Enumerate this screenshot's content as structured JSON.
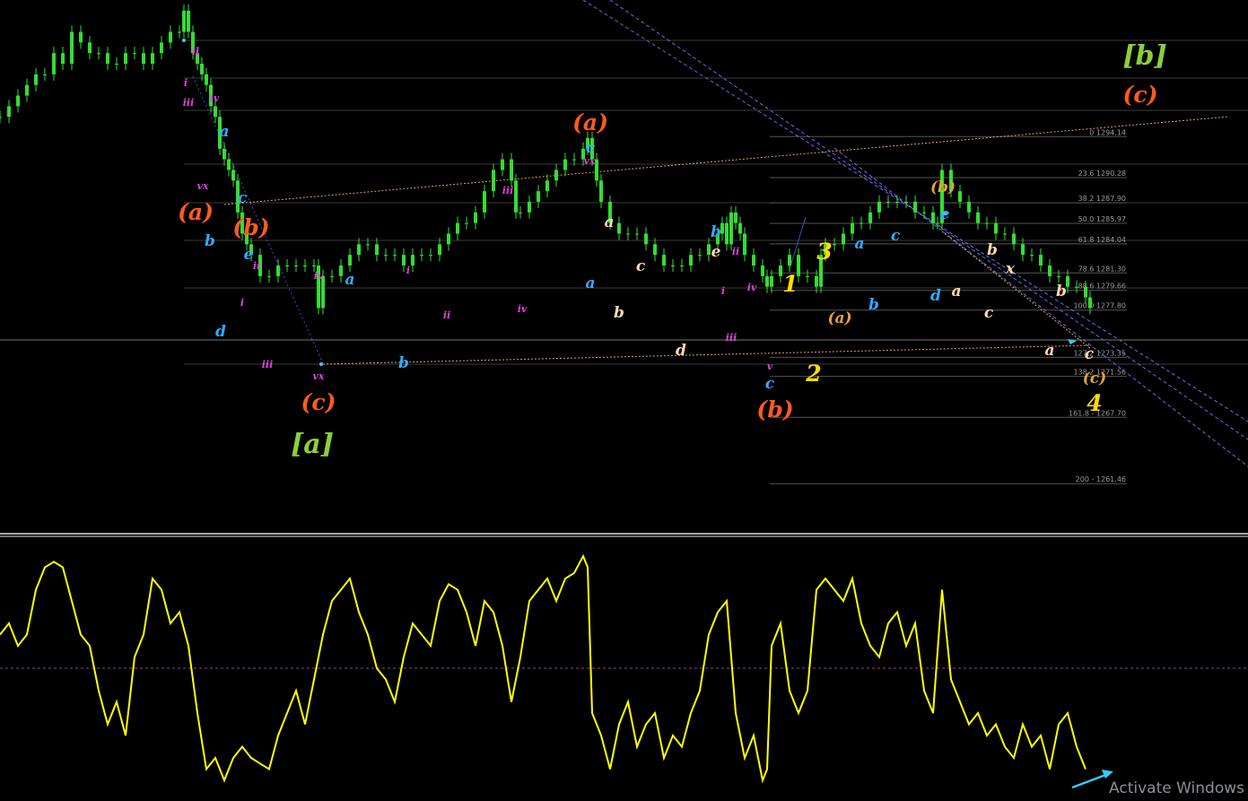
{
  "window": {
    "watermark": "Activate Windows"
  },
  "colors": {
    "background": "#000000",
    "candle": "#33dd33",
    "oscillator": "#ffff00",
    "grid": "#3a3a3a",
    "fib": "#555555",
    "channel": "#6a6ae8",
    "dotted_orange": "#e8a060",
    "osc_mid": "#aa33aa",
    "separator": "#e0e0e0",
    "arrow": "#33ccff"
  },
  "chart_data": [
    {
      "type": "candlestick",
      "title": "",
      "xlabel": "",
      "ylabel": "",
      "ylim": [
        1257,
        1307
      ],
      "x": [
        0,
        10,
        20,
        30,
        40,
        50,
        60,
        70,
        80,
        90,
        100,
        110,
        120,
        130,
        140,
        150,
        160,
        170,
        180,
        190,
        200,
        205,
        210,
        215,
        220,
        225,
        230,
        235,
        240,
        245,
        250,
        255,
        260,
        265,
        270,
        275,
        280,
        290,
        300,
        310,
        320,
        330,
        340,
        350,
        355,
        360,
        370,
        380,
        390,
        400,
        410,
        420,
        430,
        440,
        450,
        460,
        470,
        480,
        490,
        500,
        510,
        520,
        530,
        540,
        550,
        560,
        570,
        575,
        580,
        590,
        600,
        610,
        620,
        630,
        640,
        650,
        655,
        660,
        665,
        670,
        680,
        690,
        700,
        710,
        720,
        730,
        740,
        750,
        760,
        770,
        780,
        790,
        800,
        805,
        810,
        815,
        820,
        825,
        830,
        840,
        850,
        855,
        860,
        870,
        880,
        890,
        900,
        910,
        915,
        920,
        930,
        940,
        950,
        960,
        970,
        980,
        990,
        1000,
        1010,
        1020,
        1030,
        1040,
        1045,
        1050,
        1060,
        1070,
        1080,
        1090,
        1100,
        1110,
        1120,
        1130,
        1140,
        1150,
        1160,
        1170,
        1180,
        1190,
        1200,
        1210,
        1215
      ],
      "values": [
        1296,
        1297,
        1298,
        1299,
        1300,
        1300,
        1302,
        1301,
        1304,
        1303,
        1302,
        1302,
        1301,
        1301,
        1302,
        1302,
        1301,
        1302,
        1303,
        1304,
        1304,
        1306,
        1304,
        1302,
        1301,
        1300,
        1299,
        1297,
        1296,
        1293,
        1292,
        1291,
        1290,
        1287,
        1285,
        1284,
        1283,
        1281,
        1281,
        1282,
        1282,
        1282,
        1282,
        1282,
        1278,
        1281,
        1281,
        1282,
        1283,
        1284,
        1284,
        1283,
        1283,
        1283,
        1282,
        1283,
        1283,
        1283,
        1284,
        1285,
        1286,
        1286,
        1287,
        1289,
        1291,
        1292,
        1290,
        1287,
        1287,
        1288,
        1289,
        1290,
        1291,
        1292,
        1292,
        1293,
        1294,
        1292,
        1290,
        1288,
        1286,
        1285,
        1285,
        1285,
        1284,
        1283,
        1282,
        1282,
        1282,
        1283,
        1283,
        1284,
        1285,
        1286,
        1284,
        1287,
        1286,
        1285,
        1283,
        1282,
        1281,
        1280,
        1281,
        1282,
        1283,
        1281,
        1281,
        1280,
        1283,
        1284,
        1284,
        1285,
        1286,
        1286,
        1287,
        1288,
        1288,
        1288,
        1288,
        1287,
        1287,
        1286,
        1286,
        1291,
        1289,
        1288,
        1287,
        1286,
        1286,
        1285,
        1285,
        1284,
        1283,
        1283,
        1282,
        1281,
        1281,
        1280,
        1280,
        1279,
        1278
      ]
    },
    {
      "type": "line",
      "title": "",
      "ylim": [
        -1,
        1
      ],
      "x": [
        0,
        10,
        20,
        30,
        40,
        50,
        60,
        70,
        80,
        90,
        100,
        110,
        120,
        130,
        140,
        150,
        160,
        170,
        180,
        190,
        200,
        210,
        220,
        230,
        240,
        250,
        260,
        270,
        280,
        290,
        300,
        310,
        320,
        330,
        340,
        350,
        360,
        370,
        380,
        390,
        400,
        410,
        420,
        430,
        440,
        450,
        460,
        470,
        480,
        490,
        500,
        510,
        520,
        530,
        540,
        550,
        560,
        570,
        580,
        590,
        600,
        610,
        620,
        630,
        640,
        650,
        655,
        660,
        670,
        680,
        690,
        700,
        710,
        720,
        730,
        740,
        750,
        760,
        770,
        780,
        790,
        800,
        810,
        820,
        830,
        840,
        850,
        855,
        860,
        870,
        880,
        890,
        900,
        910,
        920,
        930,
        940,
        950,
        960,
        970,
        980,
        990,
        1000,
        1010,
        1020,
        1030,
        1040,
        1050,
        1060,
        1070,
        1080,
        1090,
        1100,
        1110,
        1120,
        1130,
        1140,
        1150,
        1160,
        1170,
        1180,
        1190,
        1200,
        1210
      ],
      "values": [
        0.3,
        0.4,
        0.2,
        0.3,
        0.7,
        0.9,
        0.95,
        0.9,
        0.6,
        0.3,
        0.2,
        -0.2,
        -0.5,
        -0.3,
        -0.6,
        0.1,
        0.3,
        0.8,
        0.7,
        0.4,
        0.5,
        0.2,
        -0.4,
        -0.9,
        -0.8,
        -1.0,
        -0.8,
        -0.7,
        -0.8,
        -0.85,
        -0.9,
        -0.6,
        -0.4,
        -0.2,
        -0.5,
        -0.1,
        0.3,
        0.6,
        0.7,
        0.8,
        0.5,
        0.3,
        0.0,
        -0.1,
        -0.3,
        0.1,
        0.4,
        0.3,
        0.2,
        0.6,
        0.75,
        0.7,
        0.5,
        0.2,
        0.6,
        0.5,
        0.2,
        -0.3,
        0.1,
        0.6,
        0.7,
        0.8,
        0.6,
        0.8,
        0.85,
        1.0,
        0.9,
        -0.4,
        -0.6,
        -0.9,
        -0.5,
        -0.3,
        -0.7,
        -0.5,
        -0.4,
        -0.8,
        -0.6,
        -0.7,
        -0.4,
        -0.2,
        0.3,
        0.5,
        0.6,
        -0.4,
        -0.8,
        -0.6,
        -1.0,
        -0.9,
        0.2,
        0.4,
        -0.2,
        -0.4,
        -0.2,
        0.7,
        0.8,
        0.7,
        0.6,
        0.8,
        0.4,
        0.2,
        0.1,
        0.4,
        0.5,
        0.2,
        0.4,
        -0.2,
        -0.4,
        0.7,
        -0.1,
        -0.3,
        -0.5,
        -0.4,
        -0.6,
        -0.5,
        -0.7,
        -0.8,
        -0.5,
        -0.7,
        -0.6,
        -0.9,
        -0.5,
        -0.4,
        -0.7,
        -0.9
      ]
    }
  ],
  "fib_levels": [
    {
      "label": "0 1294.14",
      "price": 1294.14
    },
    {
      "label": "23.6 1290.28",
      "price": 1290.28
    },
    {
      "label": "38.2 1287.90",
      "price": 1287.9
    },
    {
      "label": "50.0 1285.97",
      "price": 1285.97
    },
    {
      "label": "61.8 1284.04",
      "price": 1284.04
    },
    {
      "label": "78.6 1281.30",
      "price": 1281.3
    },
    {
      "label": "88.6 1279.66",
      "price": 1279.66
    },
    {
      "label": "100.0 1277.80",
      "price": 1277.8
    },
    {
      "label": "127.2 1273.35",
      "price": 1273.35
    },
    {
      "label": "138.2 1271.56",
      "price": 1271.56
    },
    {
      "label": "161.8 - 1267.70",
      "price": 1267.7
    },
    {
      "label": "200 - 1261.46",
      "price": 1261.46
    }
  ],
  "wave_labels": [
    {
      "text": "[b]",
      "color": "#8ecf3a",
      "size": "xl"
    },
    {
      "text": "(c)",
      "color": "#ff5a1f",
      "size": "l"
    },
    {
      "text": "(a)",
      "color": "#ff5a1f",
      "size": "l"
    },
    {
      "text": "(a)",
      "color": "#ff5a1f",
      "size": "l"
    },
    {
      "text": "(b)",
      "color": "#ff5a1f",
      "size": "l"
    },
    {
      "text": "(c)",
      "color": "#ff5a1f",
      "size": "l"
    },
    {
      "text": "(b)",
      "color": "#ff5a1f",
      "size": "l"
    },
    {
      "text": "[a]",
      "color": "#8ecf3a",
      "size": "xl"
    },
    {
      "text": "ii",
      "color": "#e040e0",
      "size": "s"
    },
    {
      "text": "i",
      "color": "#e040e0",
      "size": "s"
    },
    {
      "text": "iv",
      "color": "#e040e0",
      "size": "s"
    },
    {
      "text": "iii",
      "color": "#e040e0",
      "size": "s"
    },
    {
      "text": "vx",
      "color": "#e040e0",
      "size": "s"
    },
    {
      "text": "ii",
      "color": "#e040e0",
      "size": "s"
    },
    {
      "text": "i",
      "color": "#e040e0",
      "size": "s"
    },
    {
      "text": "iii",
      "color": "#e040e0",
      "size": "s"
    },
    {
      "text": "iv",
      "color": "#e040e0",
      "size": "s"
    },
    {
      "text": "vx",
      "color": "#e040e0",
      "size": "s"
    },
    {
      "text": "i",
      "color": "#e040e0",
      "size": "s"
    },
    {
      "text": "ii",
      "color": "#e040e0",
      "size": "s"
    },
    {
      "text": "iii",
      "color": "#e040e0",
      "size": "s"
    },
    {
      "text": "iv",
      "color": "#e040e0",
      "size": "s"
    },
    {
      "text": "vx",
      "color": "#e040e0",
      "size": "s"
    },
    {
      "text": "ii",
      "color": "#e040e0",
      "size": "s"
    },
    {
      "text": "i",
      "color": "#e040e0",
      "size": "s"
    },
    {
      "text": "iii",
      "color": "#e040e0",
      "size": "s"
    },
    {
      "text": "iv",
      "color": "#e040e0",
      "size": "s"
    },
    {
      "text": "v",
      "color": "#e040e0",
      "size": "s"
    },
    {
      "text": "a",
      "color": "#33aaff",
      "size": "m"
    },
    {
      "text": "b",
      "color": "#33aaff",
      "size": "m"
    },
    {
      "text": "c",
      "color": "#33aaff",
      "size": "m"
    },
    {
      "text": "d",
      "color": "#33aaff",
      "size": "m"
    },
    {
      "text": "e",
      "color": "#33aaff",
      "size": "m"
    },
    {
      "text": "a",
      "color": "#33aaff",
      "size": "m"
    },
    {
      "text": "b",
      "color": "#33aaff",
      "size": "m"
    },
    {
      "text": "c",
      "color": "#33aaff",
      "size": "m"
    },
    {
      "text": "a",
      "color": "#33aaff",
      "size": "m"
    },
    {
      "text": "b",
      "color": "#33aaff",
      "size": "m"
    },
    {
      "text": "c",
      "color": "#33aaff",
      "size": "m"
    },
    {
      "text": "a",
      "color": "#33aaff",
      "size": "m"
    },
    {
      "text": "b",
      "color": "#33aaff",
      "size": "m"
    },
    {
      "text": "c",
      "color": "#33aaff",
      "size": "m"
    },
    {
      "text": "d",
      "color": "#33aaff",
      "size": "m"
    },
    {
      "text": "e",
      "color": "#33aaff",
      "size": "m"
    },
    {
      "text": "a",
      "color": "#ffd9b0",
      "size": "m"
    },
    {
      "text": "b",
      "color": "#ffd9b0",
      "size": "m"
    },
    {
      "text": "c",
      "color": "#ffd9b0",
      "size": "m"
    },
    {
      "text": "d",
      "color": "#ffd9b0",
      "size": "m"
    },
    {
      "text": "e",
      "color": "#ffd9b0",
      "size": "m"
    },
    {
      "text": "a",
      "color": "#ffd9b0",
      "size": "m"
    },
    {
      "text": "b",
      "color": "#ffd9b0",
      "size": "m"
    },
    {
      "text": "c",
      "color": "#ffd9b0",
      "size": "m"
    },
    {
      "text": "x",
      "color": "#ffd9b0",
      "size": "m"
    },
    {
      "text": "a",
      "color": "#ffd9b0",
      "size": "m"
    },
    {
      "text": "b",
      "color": "#ffd9b0",
      "size": "m"
    },
    {
      "text": "c",
      "color": "#ffd9b0",
      "size": "m"
    },
    {
      "text": "1",
      "color": "#ffdd00",
      "size": "l"
    },
    {
      "text": "2",
      "color": "#ffdd00",
      "size": "l"
    },
    {
      "text": "3",
      "color": "#ffdd00",
      "size": "l"
    },
    {
      "text": "4",
      "color": "#ffdd00",
      "size": "l"
    },
    {
      "text": "(a)",
      "color": "#e6a23a",
      "size": "m"
    },
    {
      "text": "(b)",
      "color": "#e6a23a",
      "size": "m"
    },
    {
      "text": "(c)",
      "color": "#e6a23a",
      "size": "m"
    }
  ]
}
